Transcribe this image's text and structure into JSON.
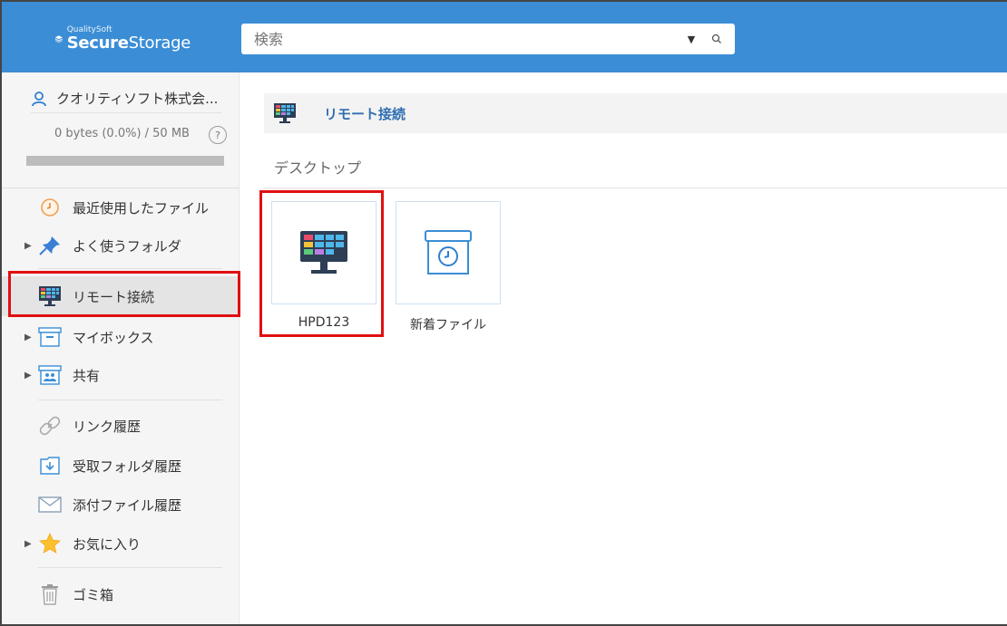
{
  "header": {
    "logo_small": "QualitySoft",
    "logo_bold": "Secure",
    "logo_regular": "Storage",
    "search_placeholder": "検索"
  },
  "sidebar": {
    "account_name": "クオリティソフト株式会...",
    "usage_text": "0 bytes (0.0%) / 50 MB",
    "help_label": "?",
    "usage_fraction": 0.0,
    "items": [
      {
        "label": "最近使用したファイル",
        "icon": "clock-icon"
      },
      {
        "label": "よく使うフォルダ",
        "icon": "pin-icon"
      },
      {
        "label": "リモート接続",
        "icon": "monitor-icon"
      },
      {
        "label": "マイボックス",
        "icon": "box-icon"
      },
      {
        "label": "共有",
        "icon": "shared-box-icon"
      },
      {
        "label": "リンク履歴",
        "icon": "link-icon"
      },
      {
        "label": "受取フォルダ履歴",
        "icon": "inbox-icon"
      },
      {
        "label": "添付ファイル履歴",
        "icon": "mail-icon"
      },
      {
        "label": "お気に入り",
        "icon": "star-icon"
      },
      {
        "label": "ゴミ箱",
        "icon": "trash-icon"
      }
    ]
  },
  "main": {
    "breadcrumb_title": "リモート接続",
    "section_title": "デスクトップ",
    "tiles": [
      {
        "label": "HPD123",
        "icon": "monitor-icon"
      },
      {
        "label": "新着ファイル",
        "icon": "new-files-box-icon"
      }
    ]
  },
  "colors": {
    "header": "#3b8ed6",
    "accent_text": "#2f6fb0",
    "highlight_box": "#e01010",
    "tile_border": "#cfe0f2"
  }
}
